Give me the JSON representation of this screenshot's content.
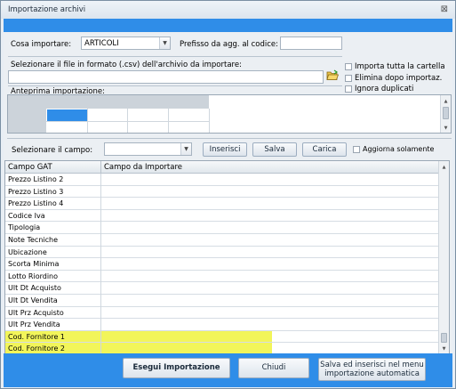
{
  "window": {
    "title": "Importazione archivi",
    "close_glyph": "⊠"
  },
  "top": {
    "cosa_label": "Cosa importare:",
    "cosa_value": "ARTICOLI",
    "prefisso_label": "Prefisso da agg. al codice:",
    "prefisso_value": "",
    "file_label": "Selezionare il file in formato (.csv) dell'archivio da importare:",
    "file_value": "",
    "anteprima_label": "Anteprima importazione:",
    "options": [
      {
        "label": "Importa tutta la cartella",
        "checked": false
      },
      {
        "label": "Elimina dopo importaz.",
        "checked": false
      },
      {
        "label": "Ignora duplicati",
        "checked": false
      }
    ]
  },
  "campo_row": {
    "label": "Selezionare il campo:",
    "value": "",
    "inserisci": "Inserisci",
    "salva": "Salva",
    "carica": "Carica",
    "aggiorna_label": "Aggiorna solamente",
    "aggiorna_checked": false
  },
  "grid": {
    "headers": [
      "Campo GAT",
      "Campo da Importare"
    ],
    "rows": [
      {
        "campo": "Prezzo Listino 2",
        "importare": "",
        "highlight": false
      },
      {
        "campo": "Prezzo Listino 3",
        "importare": "",
        "highlight": false
      },
      {
        "campo": "Prezzo Listino 4",
        "importare": "",
        "highlight": false
      },
      {
        "campo": "Codice Iva",
        "importare": "",
        "highlight": false
      },
      {
        "campo": "Tipologia",
        "importare": "",
        "highlight": false
      },
      {
        "campo": "Note Tecniche",
        "importare": "",
        "highlight": false
      },
      {
        "campo": "Ubicazione",
        "importare": "",
        "highlight": false
      },
      {
        "campo": "Scorta Minima",
        "importare": "",
        "highlight": false
      },
      {
        "campo": "Lotto Riordino",
        "importare": "",
        "highlight": false
      },
      {
        "campo": "Ult Dt Acquisto",
        "importare": "",
        "highlight": false
      },
      {
        "campo": "Ult Dt Vendita",
        "importare": "",
        "highlight": false
      },
      {
        "campo": "Ult Prz Acquisto",
        "importare": "",
        "highlight": false
      },
      {
        "campo": "Ult Prz Vendita",
        "importare": "",
        "highlight": false
      },
      {
        "campo": "Cod. Fornitore 1",
        "importare": "",
        "highlight": true
      },
      {
        "campo": "Cod. Fornitore 2",
        "importare": "",
        "highlight": true
      }
    ]
  },
  "footer": {
    "esegui": "Esegui Importazione",
    "chiudi": "Chiudi",
    "salva_menu_line1": "Salva ed inserisci nel menu",
    "salva_menu_line2": "importazione automatica"
  },
  "colors": {
    "accent_blue": "#2f8de8",
    "highlight_yellow": "#f2f55a"
  },
  "icons": {
    "folder": "folder-open-icon"
  }
}
